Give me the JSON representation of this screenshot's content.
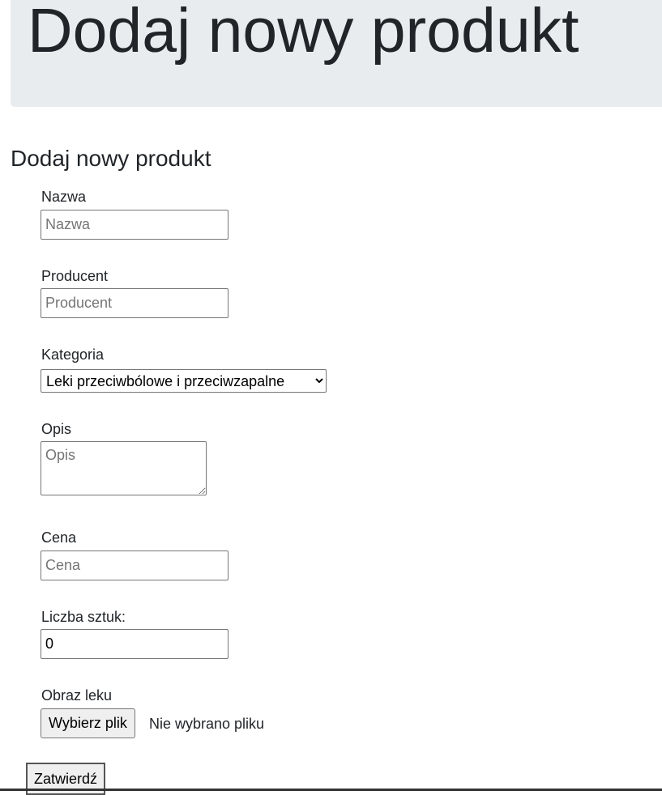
{
  "header": {
    "title": "Dodaj nowy produkt"
  },
  "form": {
    "heading": "Dodaj nowy produkt",
    "name": {
      "label": "Nazwa",
      "placeholder": "Nazwa",
      "value": ""
    },
    "producer": {
      "label": "Producent",
      "placeholder": "Producent",
      "value": ""
    },
    "category": {
      "label": "Kategoria",
      "selected": "Leki przeciwbólowe i przeciwzapalne"
    },
    "description": {
      "label": "Opis",
      "placeholder": "Opis"
    },
    "price": {
      "label": "Cena",
      "placeholder": "Cena",
      "value": ""
    },
    "quantity": {
      "label": "Liczba sztuk:",
      "value": "0"
    },
    "image": {
      "label": "Obraz leku",
      "button": "Wybierz plik",
      "status": "Nie wybrano pliku"
    },
    "submit": "Zatwierdź"
  }
}
